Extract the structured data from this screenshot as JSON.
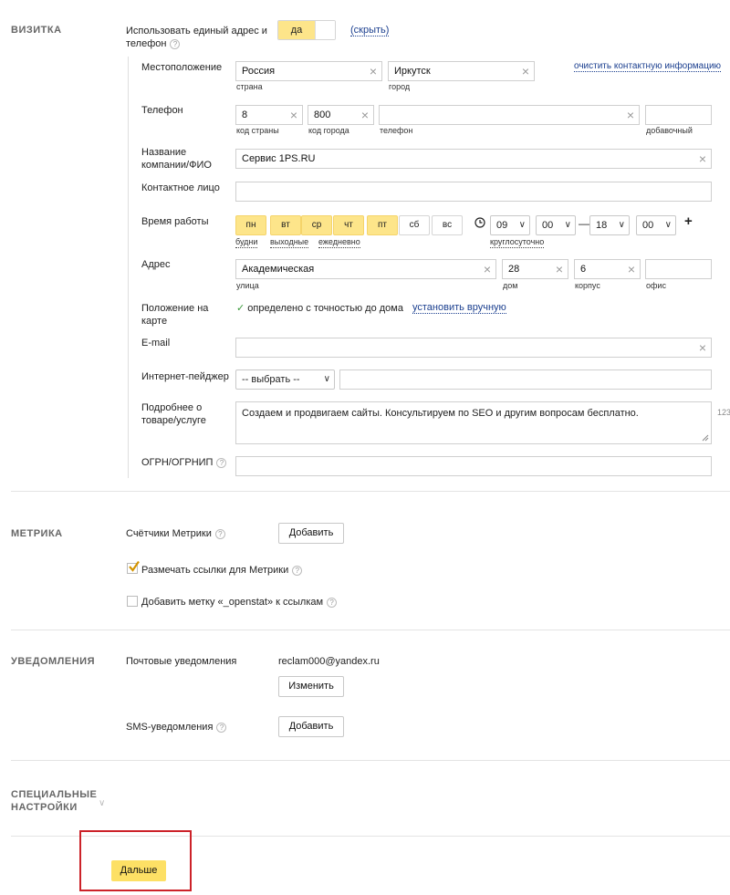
{
  "vizitka": {
    "section_title": "ВИЗИТКА",
    "unified_label": "Использовать единый адрес и телефон",
    "toggle_yes": "да",
    "hide_link": "(скрыть)",
    "location": {
      "label": "Местоположение",
      "country": "Россия",
      "country_sub": "страна",
      "city": "Иркутск",
      "city_sub": "город",
      "clear_link": "очистить контактную информацию"
    },
    "phone": {
      "label": "Телефон",
      "country_code": "8",
      "country_code_sub": "код страны",
      "city_code": "800",
      "city_code_sub": "код города",
      "number": "",
      "number_sub": "телефон",
      "ext": "",
      "ext_sub": "добавочный"
    },
    "company": {
      "label": "Название компании/ФИО",
      "value": "Сервис 1PS.RU"
    },
    "contact": {
      "label": "Контактное лицо",
      "value": ""
    },
    "hours": {
      "label": "Время работы",
      "days": [
        {
          "label": "пн",
          "on": true
        },
        {
          "label": "вт",
          "on": true
        },
        {
          "label": "ср",
          "on": true
        },
        {
          "label": "чт",
          "on": true
        },
        {
          "label": "пт",
          "on": true
        },
        {
          "label": "сб",
          "on": false
        },
        {
          "label": "вс",
          "on": false
        }
      ],
      "presets": [
        "будни",
        "выходные",
        "ежедневно"
      ],
      "from_h": "09",
      "from_m": "00",
      "dash": "—",
      "to_h": "18",
      "to_m": "00",
      "plus": "+",
      "round_clock": "круглосуточно"
    },
    "address": {
      "label": "Адрес",
      "street": "Академическая",
      "street_sub": "улица",
      "house": "28",
      "house_sub": "дом",
      "building": "6",
      "building_sub": "корпус",
      "office": "",
      "office_sub": "офис"
    },
    "map": {
      "label": "Положение на карте",
      "status": "определено с точностью до дома",
      "set_link": "установить вручную"
    },
    "email": {
      "label": "E-mail",
      "value": ""
    },
    "pager": {
      "label": "Интернет-пейджер",
      "select": "-- выбрать --",
      "value": ""
    },
    "details": {
      "label": "Подробнее о товаре/услуге",
      "value": "Создаем и продвигаем сайты. Консультируем по SEO и другим вопросам бесплатно.",
      "counter": "123"
    },
    "ogrn": {
      "label": "ОГРН/ОГРНИП",
      "value": ""
    }
  },
  "metrika": {
    "section_title": "МЕТРИКА",
    "counters_label": "Счётчики Метрики",
    "add_button": "Добавить",
    "mark_links_label": "Размечать ссылки для Метрики",
    "mark_links_checked": true,
    "openstat_label": "Добавить метку «_openstat» к ссылкам",
    "openstat_checked": false
  },
  "notifications": {
    "section_title": "УВЕДОМЛЕНИЯ",
    "mail_label": "Почтовые уведомления",
    "email": "reclam000@yandex.ru",
    "change_button": "Изменить",
    "sms_label": "SMS-уведомления",
    "sms_add_button": "Добавить"
  },
  "special": {
    "section_title": "СПЕЦИАЛЬНЫЕ НАСТРОЙКИ"
  },
  "footer": {
    "next_button": "Дальше"
  },
  "colors": {
    "accent_yellow": "#fde58a",
    "highlight_red": "#cc2229",
    "link_blue": "#1b3f8f"
  }
}
